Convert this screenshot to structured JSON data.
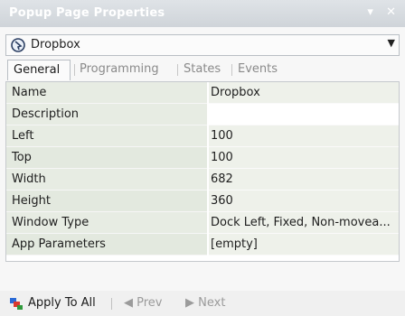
{
  "window": {
    "title": "Popup Page Properties"
  },
  "titlebar_icons": [
    "pin-dropdown-icon",
    "close-icon"
  ],
  "selector": {
    "label": "Dropbox",
    "icon": "dropbox-page-icon"
  },
  "tabs": [
    {
      "label": "General",
      "active": true
    },
    {
      "label": "Programming",
      "active": false
    },
    {
      "label": "States",
      "active": false
    },
    {
      "label": "Events",
      "active": false
    }
  ],
  "properties": [
    {
      "name": "Name",
      "value": "Dropbox"
    },
    {
      "name": "Description",
      "value": ""
    },
    {
      "name": "Left",
      "value": "100"
    },
    {
      "name": "Top",
      "value": "100"
    },
    {
      "name": "Width",
      "value": "682"
    },
    {
      "name": "Height",
      "value": "360"
    },
    {
      "name": "Window Type",
      "value": "Dock Left, Fixed, Non-movea..."
    },
    {
      "name": "App Parameters",
      "value": "[empty]"
    }
  ],
  "footer": {
    "apply_label": "Apply To All",
    "prev_label": "Prev",
    "next_label": "Next"
  },
  "colors": {
    "titlebar": "#d7dbe0",
    "name_cell": "#e7ece3",
    "value_cell": "#eef1ea"
  }
}
